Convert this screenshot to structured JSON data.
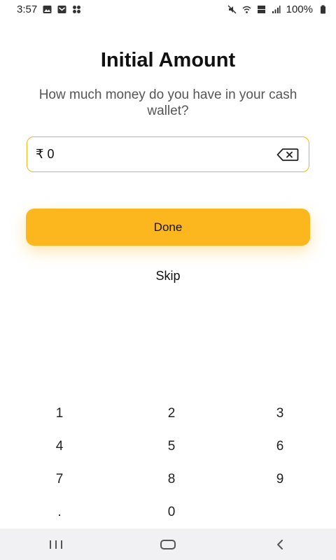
{
  "status_bar": {
    "time": "3:57",
    "battery": "100%",
    "left_icons": [
      "gallery-icon",
      "mail-icon",
      "apps-icon"
    ],
    "right_icons": [
      "mute-icon",
      "wifi-icon",
      "volte-icon",
      "signal-icon",
      "battery-icon"
    ]
  },
  "header": {
    "title": "Initial Amount",
    "subtitle": "How much money do you have in your cash wallet?"
  },
  "amount_input": {
    "currency_symbol": "₹",
    "value": "0",
    "display": "₹ 0"
  },
  "actions": {
    "done_label": "Done",
    "skip_label": "Skip"
  },
  "keypad": {
    "keys": [
      "1",
      "2",
      "3",
      "4",
      "5",
      "6",
      "7",
      "8",
      "9",
      ".",
      "0"
    ]
  },
  "colors": {
    "accent": "#fcb71e",
    "field_border": "#f2b317",
    "nav_bar": "#f1f1f3"
  }
}
